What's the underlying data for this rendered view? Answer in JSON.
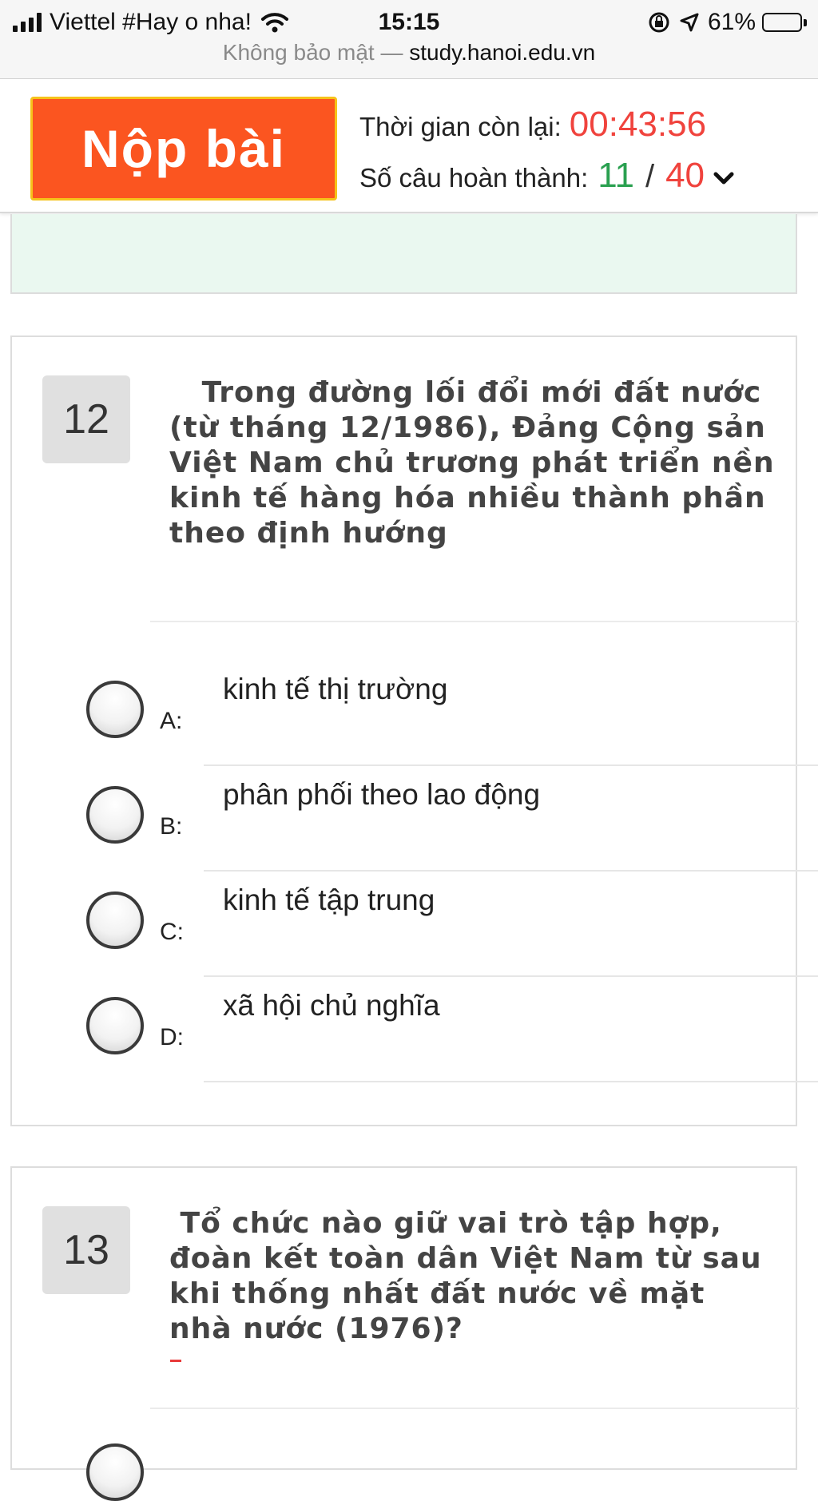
{
  "status_bar": {
    "carrier": "Viettel #Hay o nha!",
    "time": "15:15",
    "battery_percent": "61%",
    "battery_level": 0.61,
    "url_insecure": "Không bảo mật —",
    "url_host": "study.hanoi.edu.vn"
  },
  "header": {
    "submit_label": "Nộp bài",
    "time_left_label": "Thời gian còn lại:",
    "time_left_value": "00:43:56",
    "completed_label": "Số câu hoàn thành:",
    "completed_count": "11",
    "separator": "/",
    "total_count": "40"
  },
  "questions": [
    {
      "number": "12",
      "text": "   Trong đường lối đổi mới đất nước (từ tháng 12/1986), Đảng Cộng sản Việt Nam chủ trương phát triển nền kinh tế hàng hóa nhiều thành phần theo định hướng",
      "options": [
        {
          "letter": "A:",
          "text": "kinh tế thị trường"
        },
        {
          "letter": "B:",
          "text": "phân phối theo lao động"
        },
        {
          "letter": "C:",
          "text": "kinh tế tập trung"
        },
        {
          "letter": "D:",
          "text": "xã hội chủ  nghĩa"
        }
      ]
    },
    {
      "number": "13",
      "text": " Tổ chức nào giữ vai trò tập hợp, đoàn kết toàn dân Việt Nam từ sau khi thống nhất đất nước về mặt nhà nước (1976)?"
    }
  ],
  "colors": {
    "submit_bg": "#fb5520",
    "submit_border": "#f6c21a",
    "timer": "#f0433d",
    "completed": "#2aa050",
    "prev_card_bg": "#eaf8f0"
  },
  "icons": {
    "signal": "signal-bars-icon",
    "wifi": "wifi-icon",
    "orientation_lock": "orientation-lock-icon",
    "location": "location-arrow-icon",
    "battery": "battery-icon",
    "expand": "chevron-down-icon"
  }
}
